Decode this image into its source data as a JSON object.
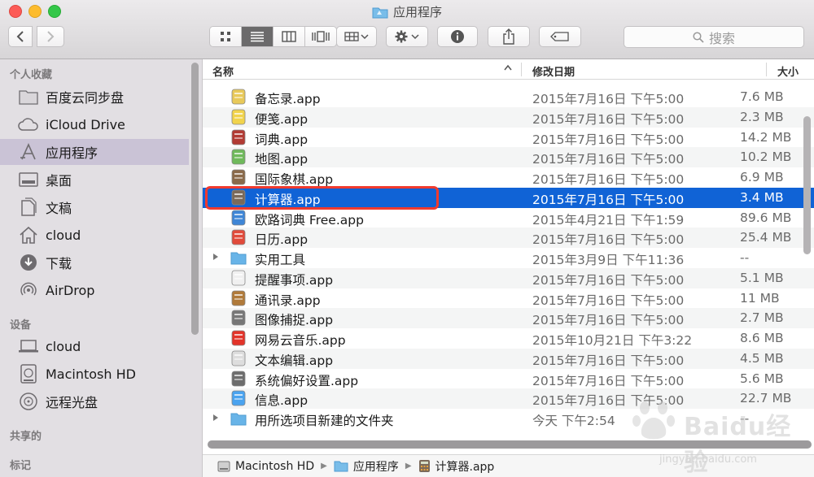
{
  "window": {
    "title": "应用程序"
  },
  "toolbar": {
    "view_buttons": [
      "icon-view",
      "list-view",
      "column-view",
      "coverflow-view"
    ],
    "active_view": 1
  },
  "search": {
    "placeholder": "搜索"
  },
  "sidebar": {
    "sections": [
      {
        "title": "个人收藏",
        "items": [
          {
            "label": "百度云同步盘",
            "icon": "folder-icon"
          },
          {
            "label": "iCloud Drive",
            "icon": "cloud-icon"
          },
          {
            "label": "应用程序",
            "icon": "applications-icon",
            "selected": true
          },
          {
            "label": "桌面",
            "icon": "desktop-icon"
          },
          {
            "label": "文稿",
            "icon": "documents-icon"
          },
          {
            "label": "cloud",
            "icon": "home-icon"
          },
          {
            "label": "下载",
            "icon": "download-icon"
          },
          {
            "label": "AirDrop",
            "icon": "airdrop-icon"
          }
        ]
      },
      {
        "title": "设备",
        "items": [
          {
            "label": "cloud",
            "icon": "laptop-icon"
          },
          {
            "label": "Macintosh HD",
            "icon": "harddisk-icon"
          },
          {
            "label": "远程光盘",
            "icon": "disc-icon"
          }
        ]
      },
      {
        "title": "共享的",
        "items": []
      },
      {
        "title": "标记",
        "items": []
      }
    ]
  },
  "columns": {
    "name": "名称",
    "date": "修改日期",
    "size": "大小"
  },
  "files": [
    {
      "name": "备忘录.app",
      "date": "2015年7月16日 下午5:00",
      "size": "7.6 MB",
      "icon": "notes-app-icon",
      "color": "#e8c95a"
    },
    {
      "name": "便笺.app",
      "date": "2015年7月16日 下午5:00",
      "size": "2.3 MB",
      "icon": "stickies-app-icon",
      "color": "#f1d34c"
    },
    {
      "name": "词典.app",
      "date": "2015年7月16日 下午5:00",
      "size": "14.2 MB",
      "icon": "dictionary-app-icon",
      "color": "#b23b34"
    },
    {
      "name": "地图.app",
      "date": "2015年7月16日 下午5:00",
      "size": "10.2 MB",
      "icon": "maps-app-icon",
      "color": "#6fb95b"
    },
    {
      "name": "国际象棋.app",
      "date": "2015年7月16日 下午5:00",
      "size": "6.9 MB",
      "icon": "chess-app-icon",
      "color": "#8a6a4a"
    },
    {
      "name": "计算器.app",
      "date": "2015年7月16日 下午5:00",
      "size": "3.4 MB",
      "icon": "calculator-app-icon",
      "color": "#7b6a5a",
      "selected": true
    },
    {
      "name": "欧路词典 Free.app",
      "date": "2015年4月21日 下午1:59",
      "size": "89.6 MB",
      "icon": "eudic-app-icon",
      "color": "#3f86d6"
    },
    {
      "name": "日历.app",
      "date": "2015年7月16日 下午5:00",
      "size": "25.4 MB",
      "icon": "calendar-app-icon",
      "color": "#e14b3b"
    },
    {
      "name": "实用工具",
      "date": "2015年3月9日 下午11:36",
      "size": "--",
      "icon": "utilities-folder-icon",
      "color": "#68b4e8",
      "folder": true
    },
    {
      "name": "提醒事项.app",
      "date": "2015年7月16日 下午5:00",
      "size": "5.1 MB",
      "icon": "reminders-app-icon",
      "color": "#f0f0f0"
    },
    {
      "name": "通讯录.app",
      "date": "2015年7月16日 下午5:00",
      "size": "11 MB",
      "icon": "contacts-app-icon",
      "color": "#b07a3a"
    },
    {
      "name": "图像捕捉.app",
      "date": "2015年7月16日 下午5:00",
      "size": "2.7 MB",
      "icon": "image-capture-app-icon",
      "color": "#777777"
    },
    {
      "name": "网易云音乐.app",
      "date": "2015年10月21日 下午3:22",
      "size": "8.6 MB",
      "icon": "netease-music-app-icon",
      "color": "#e2342a"
    },
    {
      "name": "文本编辑.app",
      "date": "2015年7月16日 下午5:00",
      "size": "4.5 MB",
      "icon": "textedit-app-icon",
      "color": "#dddddd"
    },
    {
      "name": "系统偏好设置.app",
      "date": "2015年7月16日 下午5:00",
      "size": "5.6 MB",
      "icon": "system-preferences-app-icon",
      "color": "#6d6d6d"
    },
    {
      "name": "信息.app",
      "date": "2015年7月16日 下午5:00",
      "size": "22.7 MB",
      "icon": "messages-app-icon",
      "color": "#4aa3ef"
    },
    {
      "name": "用所选项目新建的文件夹",
      "date": "今天 下午2:54",
      "size": "--",
      "icon": "folder-icon",
      "color": "#68b4e8",
      "folder": true
    }
  ],
  "pathbar": [
    {
      "label": "Macintosh HD",
      "icon": "harddisk-icon"
    },
    {
      "label": "应用程序",
      "icon": "folder-icon"
    },
    {
      "label": "计算器.app",
      "icon": "calculator-app-icon"
    }
  ],
  "watermark": {
    "brand": "Baidu经验",
    "url": "jingyan.baidu.com"
  },
  "colors": {
    "selection": "#1063d6",
    "sidebar_selection": "#cac3d6",
    "annotation": "#f03a2e"
  }
}
